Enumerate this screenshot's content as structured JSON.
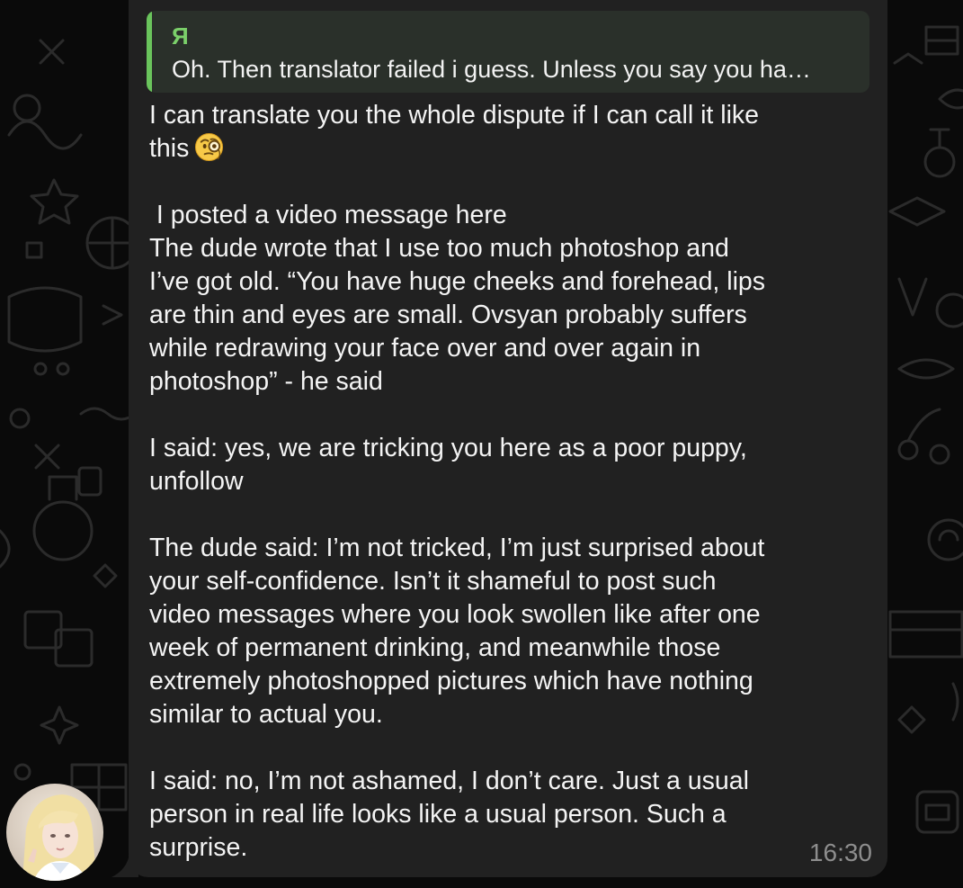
{
  "reply": {
    "author": "Я",
    "text": "Oh. Then translator failed i guess. Unless you say you ha…"
  },
  "message": {
    "paragraphs": [
      {
        "lines": [
          "I can translate you the whole dispute if I can call it like",
          "this"
        ],
        "trailing_emoji": "face-with-monocle"
      },
      {
        "lines": [
          " I posted a video message here",
          "The dude wrote that I use too much photoshop and",
          "I’ve got old. “You have huge cheeks and forehead, lips",
          "are thin and eyes are small. Ovsyan probably suffers",
          "while redrawing your face over and over again in",
          "photoshop” - he said"
        ]
      },
      {
        "lines": [
          "I said: yes, we are tricking you here as a poor puppy,",
          "unfollow"
        ]
      },
      {
        "lines": [
          "The dude said: I’m not tricked, I’m just surprised about",
          "your self-confidence. Isn’t it shameful to post such",
          "video messages where you look swollen like after one",
          "week of permanent drinking, and meanwhile those",
          "extremely photoshopped pictures which have nothing",
          "similar to actual you."
        ]
      },
      {
        "lines": [
          "I said: no, I’m not ashamed, I don’t care. Just a usual",
          "person in real life looks like a usual person. Such a",
          "surprise."
        ]
      }
    ],
    "time": "16:30"
  },
  "colors": {
    "bubble": "#212121",
    "reply_accent": "#6ac45c",
    "text": "#f4f4f4",
    "time": "#8e8e8e"
  },
  "icons": {
    "emoji": "face-with-monocle-icon",
    "avatar": "user-avatar"
  }
}
